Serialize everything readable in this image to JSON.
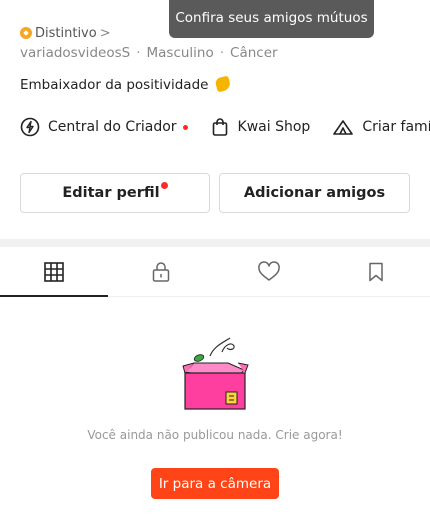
{
  "tooltip": {
    "text": "Confira seus amigos mútuos"
  },
  "profile": {
    "badge_label": "Distintivo",
    "badge_chevron": ">",
    "username": "variadosvideosS",
    "separator": "·",
    "gender": "Masculino",
    "zodiac": "Câncer",
    "bio": "Embaixador da positividade"
  },
  "links": [
    {
      "label": "Central do Criador",
      "icon": "lightning-circle-icon",
      "has_dot": true
    },
    {
      "label": "Kwai Shop",
      "icon": "shopping-bag-icon"
    },
    {
      "label": "Criar famí",
      "icon": "tent-icon"
    }
  ],
  "buttons": {
    "edit_profile": "Editar perfil",
    "add_friends": "Adicionar amigos"
  },
  "tabs": [
    {
      "name": "grid",
      "icon": "grid-icon",
      "active": true
    },
    {
      "name": "private",
      "icon": "lock-icon"
    },
    {
      "name": "liked",
      "icon": "heart-icon"
    },
    {
      "name": "saved",
      "icon": "bookmark-icon"
    }
  ],
  "empty_state": {
    "message": "Você ainda não publicou nada. Crie agora!",
    "cta": "Ir para a câmera"
  },
  "colors": {
    "accent": "#ff4417",
    "notification_dot": "#ff2b2b",
    "badge": "#f5a623",
    "box_pink": "#ff3fa0"
  }
}
